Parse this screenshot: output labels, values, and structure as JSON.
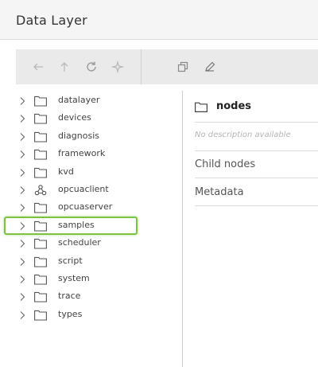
{
  "header": {
    "title": "Data Layer"
  },
  "toolbar": {
    "buttons": [
      {
        "icon": "arrow-left-icon"
      },
      {
        "icon": "arrow-up-icon"
      },
      {
        "icon": "refresh-icon"
      },
      {
        "icon": "sparkle-icon"
      },
      {
        "icon": "copy-icon"
      },
      {
        "icon": "pencil-icon"
      }
    ]
  },
  "tree": {
    "items": [
      {
        "label": "datalayer",
        "icon": "folder-icon"
      },
      {
        "label": "devices",
        "icon": "folder-icon"
      },
      {
        "label": "diagnosis",
        "icon": "folder-icon"
      },
      {
        "label": "framework",
        "icon": "folder-icon"
      },
      {
        "label": "kvd",
        "icon": "folder-icon"
      },
      {
        "label": "opcuaclient",
        "icon": "network-icon"
      },
      {
        "label": "opcuaserver",
        "icon": "folder-icon"
      },
      {
        "label": "samples",
        "icon": "folder-icon",
        "highlighted": true
      },
      {
        "label": "scheduler",
        "icon": "folder-icon"
      },
      {
        "label": "script",
        "icon": "folder-icon"
      },
      {
        "label": "system",
        "icon": "folder-icon"
      },
      {
        "label": "trace",
        "icon": "folder-icon"
      },
      {
        "label": "types",
        "icon": "folder-icon"
      }
    ]
  },
  "detail": {
    "node_name": "nodes",
    "description": "No description available",
    "sections": [
      "Child nodes",
      "Metadata"
    ]
  },
  "colors": {
    "highlight": "#7dc243",
    "toolbar_bg": "#eaeaea",
    "header_bg": "#f5f5f5"
  }
}
